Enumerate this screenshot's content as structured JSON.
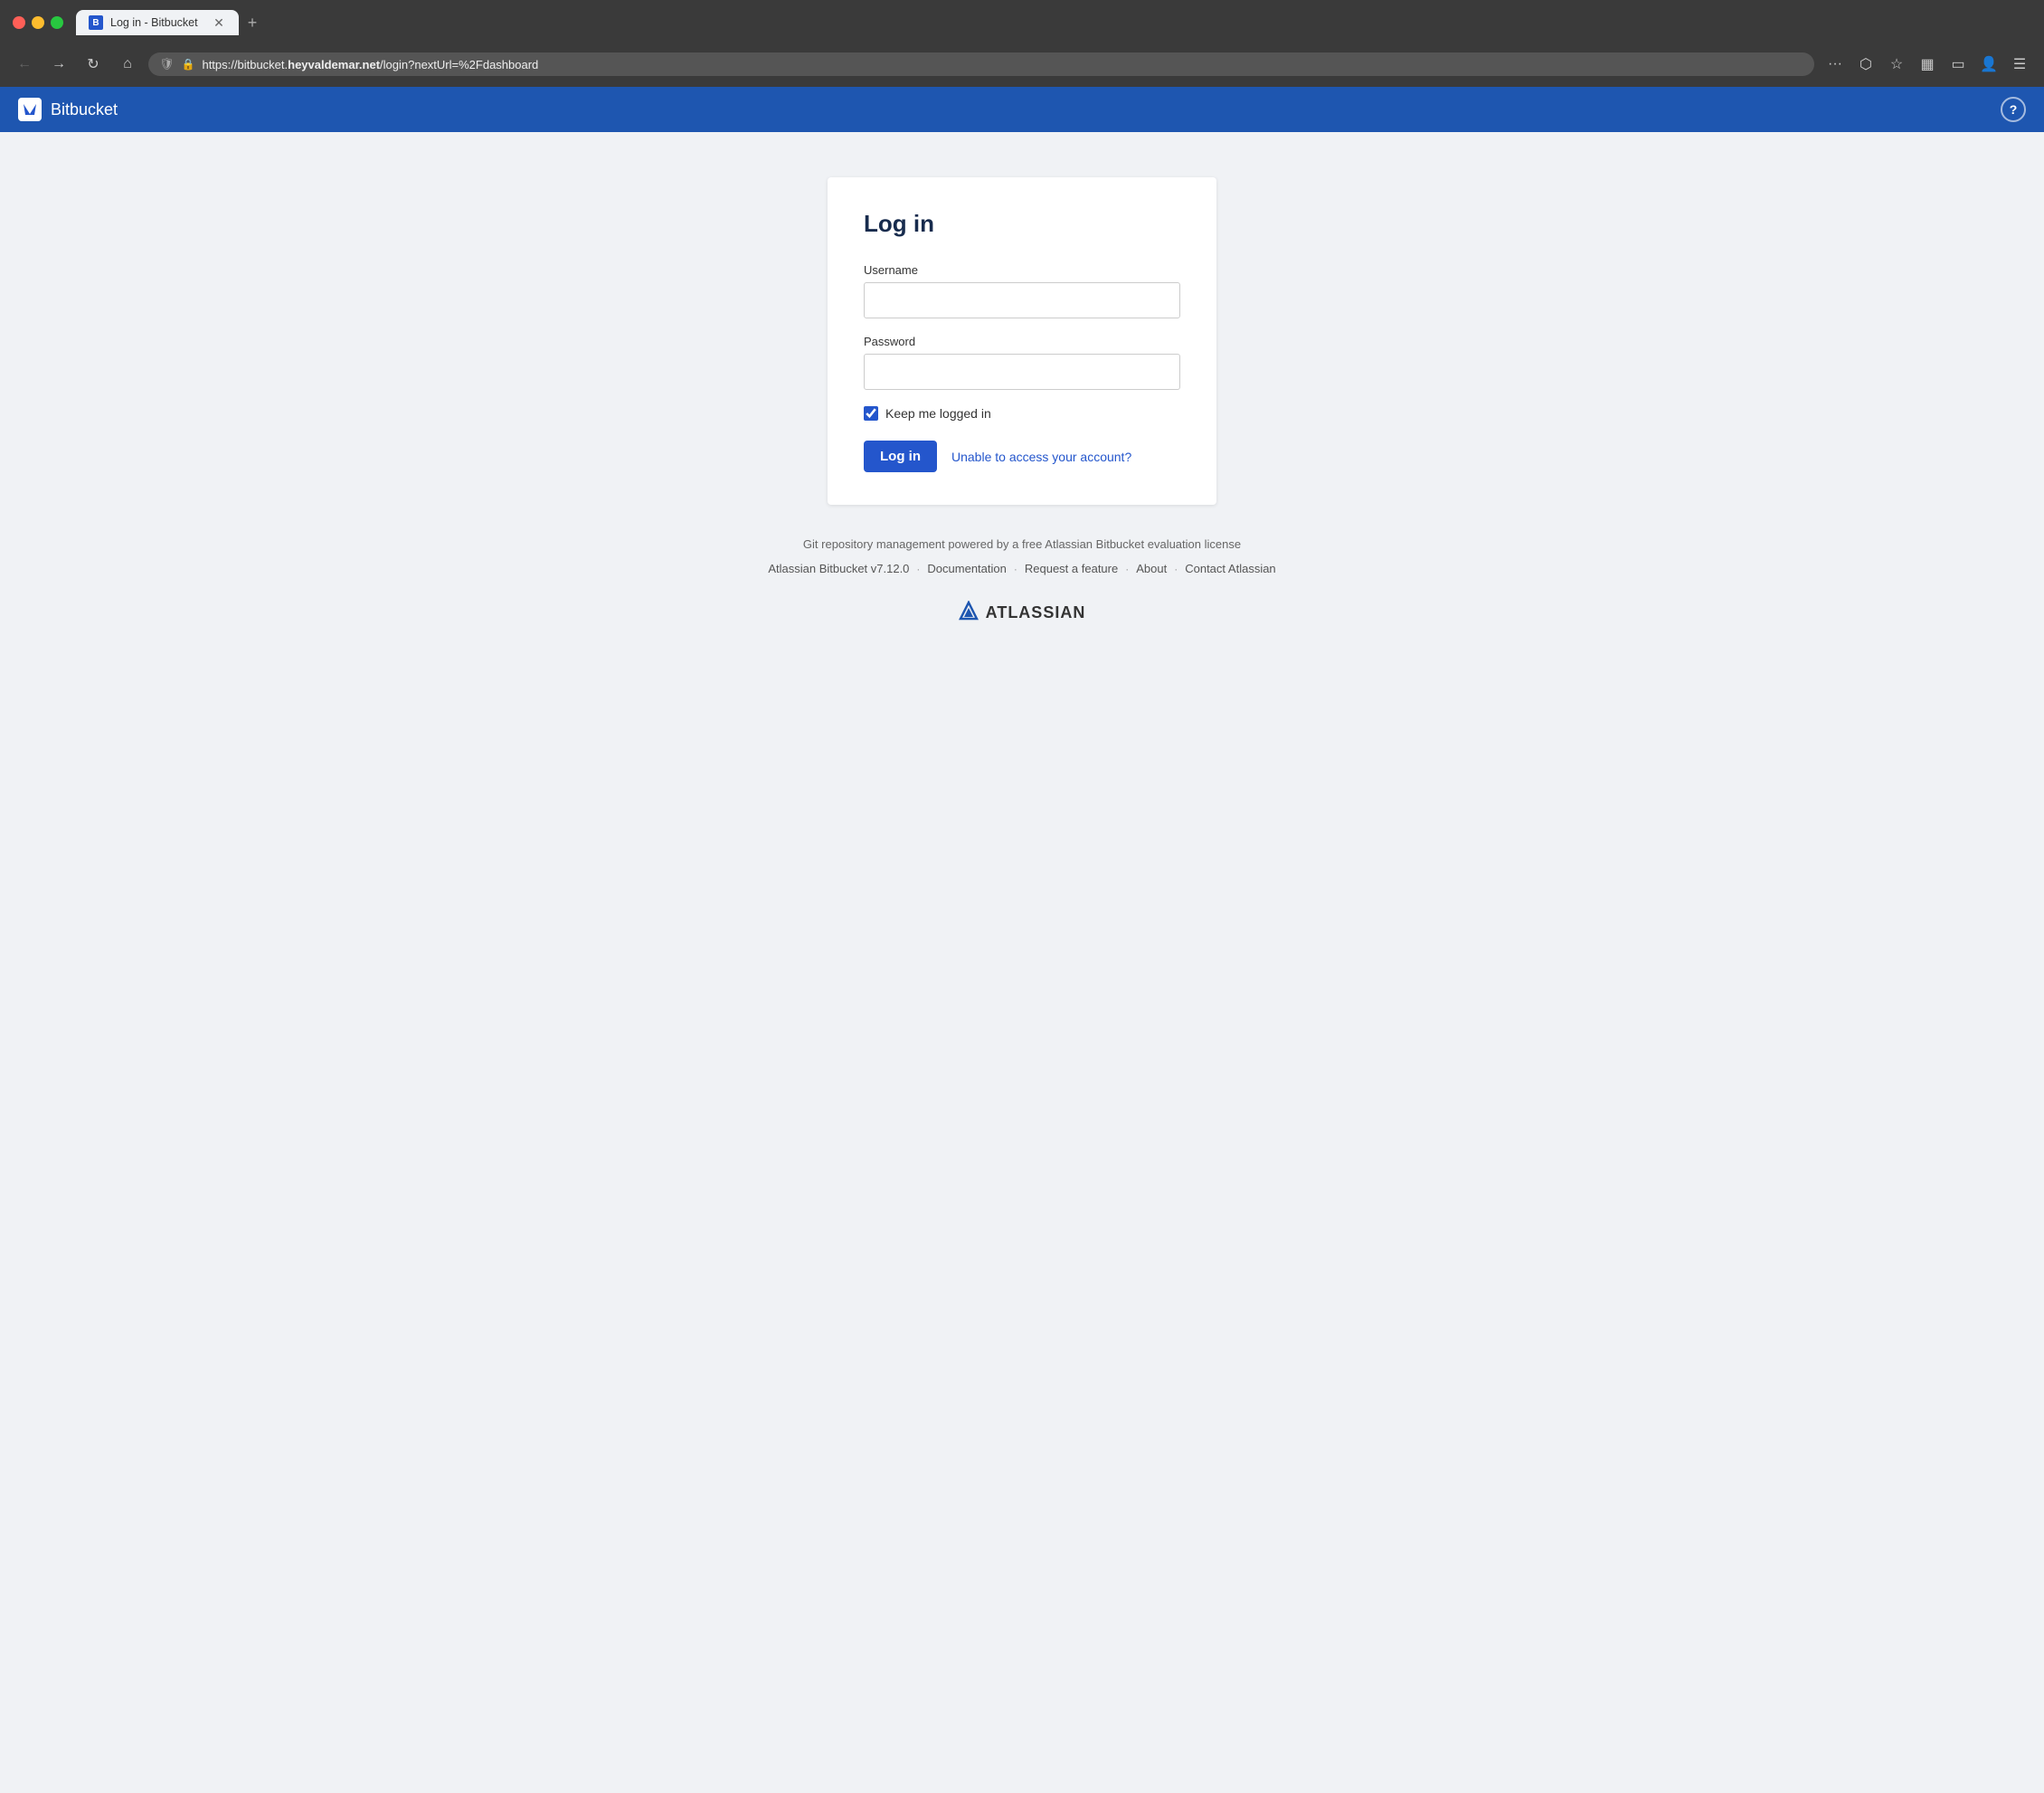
{
  "browser": {
    "tab": {
      "title": "Log in - Bitbucket",
      "favicon_label": "B"
    },
    "address": {
      "prefix": "https://bitbucket.",
      "domain": "heyvaldemar.net",
      "suffix": "/login?nextUrl=%2Fdashboard"
    }
  },
  "header": {
    "app_name": "Bitbucket",
    "help_label": "?"
  },
  "login": {
    "title": "Log in",
    "username_label": "Username",
    "username_placeholder": "",
    "password_label": "Password",
    "password_placeholder": "",
    "remember_label": "Keep me logged in",
    "submit_label": "Log in",
    "forgot_label": "Unable to access your account?"
  },
  "footer": {
    "description": "Git repository management powered by a free Atlassian Bitbucket evaluation license",
    "version": "Atlassian Bitbucket v7.12.0",
    "links": [
      {
        "label": "Documentation"
      },
      {
        "label": "Request a feature"
      },
      {
        "label": "About"
      },
      {
        "label": "Contact Atlassian"
      }
    ],
    "atlassian_label": "ATLASSIAN"
  }
}
